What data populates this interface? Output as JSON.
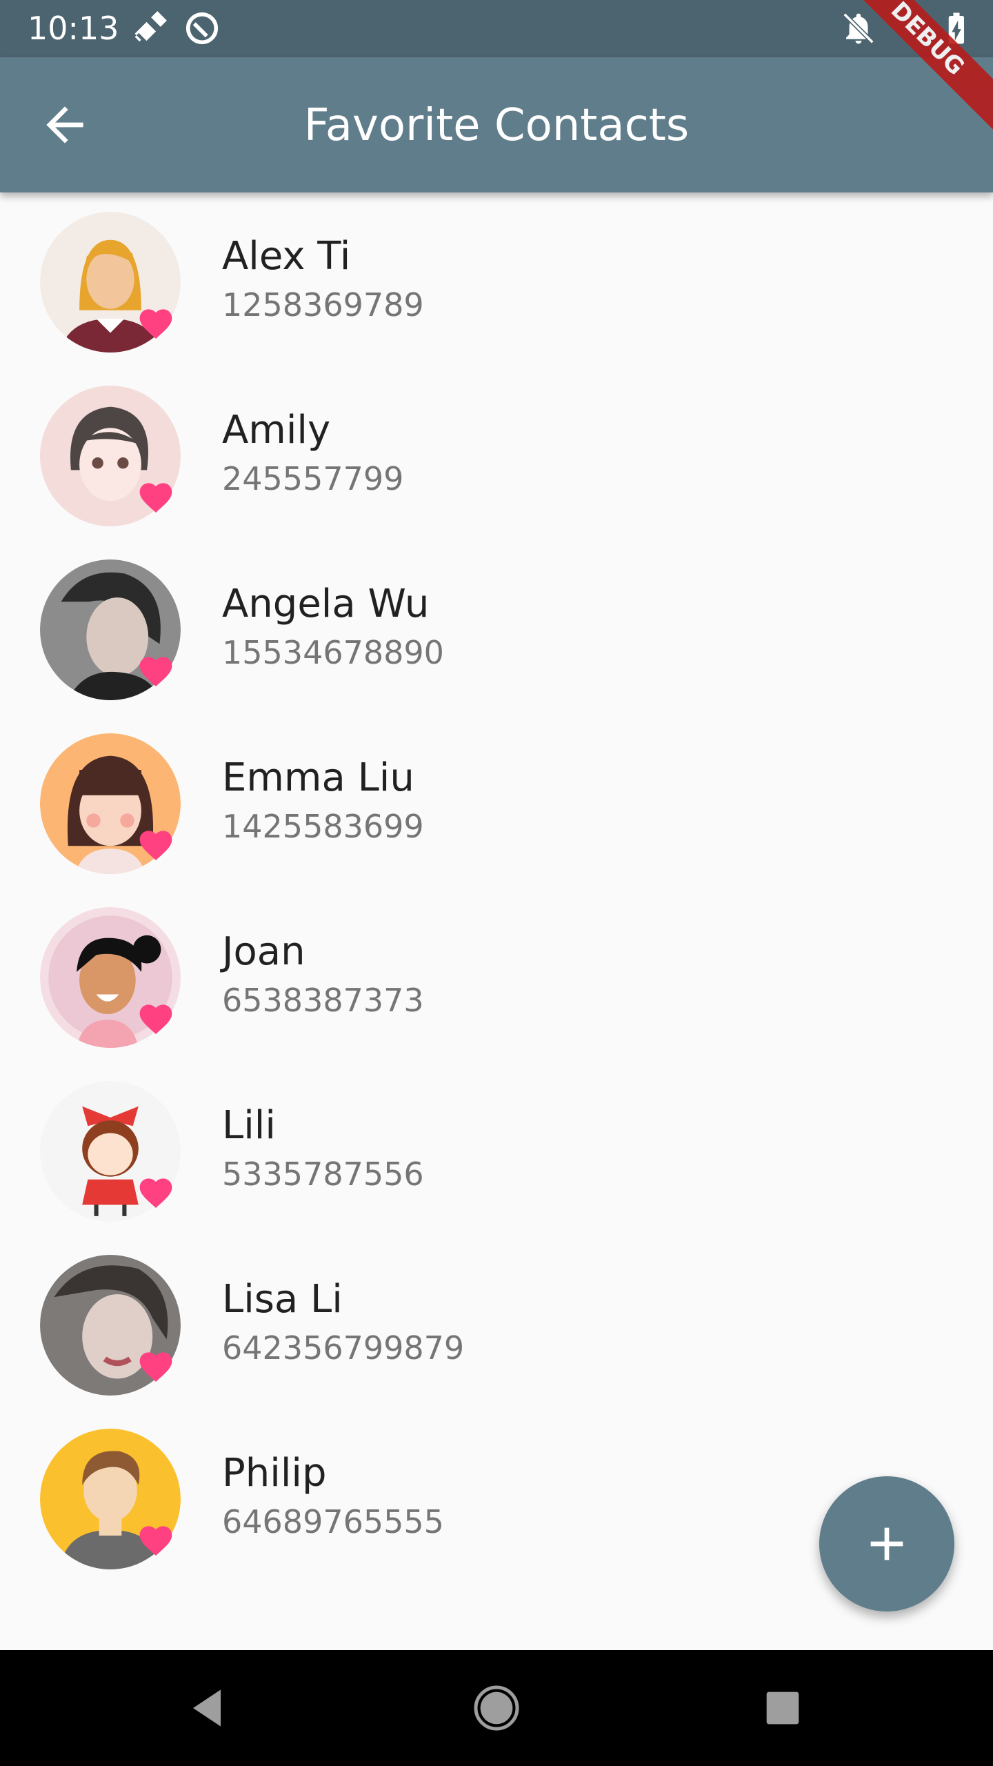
{
  "status_bar": {
    "time": "10:13"
  },
  "debug_banner": "DEBUG",
  "app_bar": {
    "title": "Favorite Contacts"
  },
  "contacts": [
    {
      "name": "Alex Ti",
      "phone": "1258369789"
    },
    {
      "name": "Amily",
      "phone": "245557799"
    },
    {
      "name": "Angela Wu",
      "phone": "15534678890"
    },
    {
      "name": "Emma Liu",
      "phone": "1425583699"
    },
    {
      "name": "Joan",
      "phone": "6538387373"
    },
    {
      "name": "Lili",
      "phone": "5335787556"
    },
    {
      "name": "Lisa Li",
      "phone": "642356799879"
    },
    {
      "name": "Philip",
      "phone": "64689765555"
    }
  ],
  "colors": {
    "app_bar": "#607d8b",
    "status_bar": "#4c6470",
    "heart": "#ff4081",
    "fab": "#607d8b"
  },
  "icons": [
    "back-arrow-icon",
    "heart-icon",
    "add-icon",
    "satellite-icon",
    "no-disturb-icon",
    "notifications-off-icon",
    "battery-charging-icon"
  ]
}
